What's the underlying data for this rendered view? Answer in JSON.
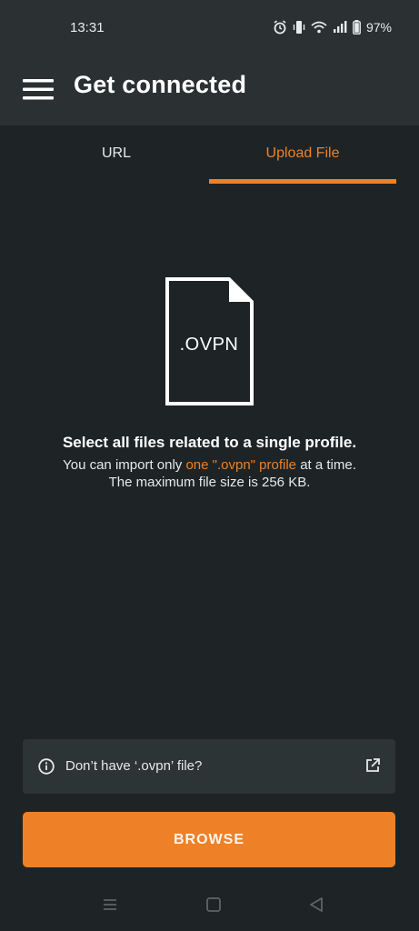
{
  "status_bar": {
    "time": "13:31",
    "battery": "97%",
    "icons": [
      "alarm-icon",
      "vibrate-icon",
      "wifi-icon",
      "signal-icon",
      "battery-icon"
    ]
  },
  "app_bar": {
    "title": "Get connected",
    "menu_icon": "hamburger-menu-icon"
  },
  "tabs": [
    {
      "label": "URL",
      "selected": false
    },
    {
      "label": "Upload File",
      "selected": true
    }
  ],
  "file_icon": {
    "extension_label": ".OVPN"
  },
  "instructions": {
    "headline": "Select all files related to a single profile.",
    "line1_before": "You can import only ",
    "line1_accent": "one \".ovpn\" profile",
    "line1_after": " at a time.",
    "line2": "The maximum file size is 256 KB."
  },
  "info_card": {
    "label": "Don’t have ‘.ovpn’ file?",
    "icon": "info-icon",
    "trailing_icon": "external-link-icon"
  },
  "browse_button": {
    "label": "BROWSE"
  },
  "colors": {
    "accent": "#ee8127",
    "background": "#1e2426",
    "app_bar": "#2b3133",
    "card": "#2d3436"
  },
  "nav_bar": {
    "icons": [
      "recents-icon",
      "home-icon",
      "back-icon"
    ]
  }
}
